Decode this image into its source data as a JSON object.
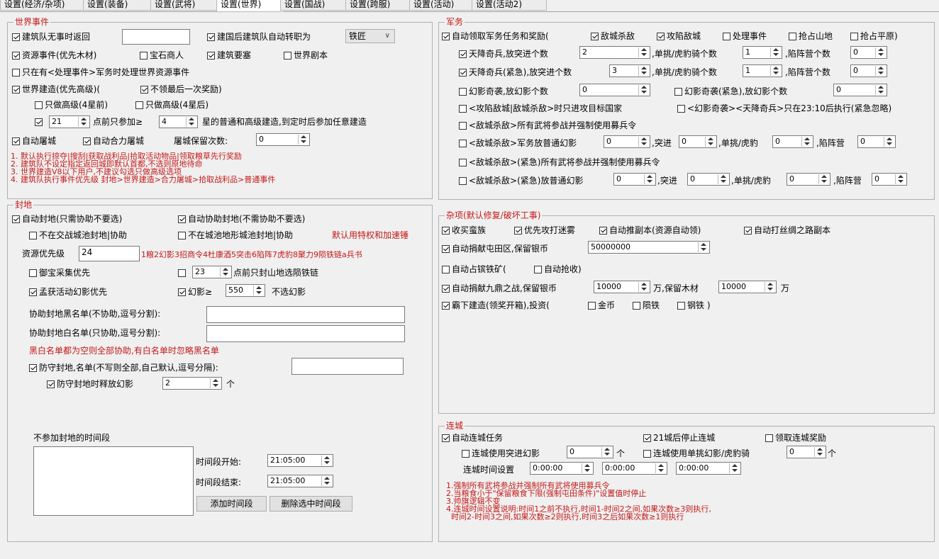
{
  "tabs": [
    {
      "label": "设置(经济/杂项)"
    },
    {
      "label": "设置(装备)"
    },
    {
      "label": "设置(武将)"
    },
    {
      "label": "设置(世界)"
    },
    {
      "label": "设置(国战)"
    },
    {
      "label": "设置(跨服)"
    },
    {
      "label": "设置(活动)"
    },
    {
      "label": "设置(活动2)"
    }
  ],
  "world": {
    "legend": "世界事件",
    "idle_return": "建筑队无事时返回",
    "idle_return_value": "",
    "auto_convert": "建国后建筑队自动转职为",
    "convert_option": "铁匠",
    "resource_event": "资源事件(优先木材)",
    "treasure_merchant": "宝石商人",
    "build_fortress": "建筑要塞",
    "world_script": "世界剧本",
    "only_handle": "只在有<处理事件>军务时处理世界资源事件",
    "world_build": "世界建造(优先高级)(",
    "no_last_reward": "不领最后一次奖励)",
    "high_before": "只做高级(4星前)",
    "high_after": "只做高级(4星后)",
    "stars_value": "21",
    "before_join": "点前只参加≥",
    "star_value": "4",
    "star_text": "星的普通和高级建造,到定时后参加任意建造",
    "auto_slay": "自动屠城",
    "auto_cooperate": "自动合力屠城",
    "slay_keep": "屠城保留次数:",
    "slay_keep_value": "0",
    "notes": [
      "1. 默认执行掠夺|搜刮|获取战利品|拾取活动物品|领取粮草先行奖励",
      "2. 建筑队不设定指定返回城即默认首都,不选则原地待命",
      "3. 世界建造V8以下用户,不建议勾选只做高级选项",
      "4. 建筑队执行事件优先级 封地>世界建造>合力屠城>拾取战利品>普通事件"
    ]
  },
  "fief": {
    "legend": "封地",
    "auto_fief": "自动封地(只需协助不要选)",
    "auto_assist": "自动协助封地(不需协助不要选)",
    "not_battle": "不在交战城池封地|协助",
    "not_terrain": "不在城池地形城池封地|协助",
    "default_use": "默认用特权和加速锤",
    "res_priority": "资源优先级",
    "res_priority_value": "24",
    "res_hint": "1粮2幻影3招商令4杜康酒5突击6陷阵7虎豹8聚力9陨铁链a兵书",
    "treasure_first": "御宝采集优先",
    "hour_value": "23",
    "before_mountain": "点前只封山地选陨铁链",
    "mengzhuo": "孟获活动幻影优先",
    "phantom": "幻影≥",
    "phantom_value": "550",
    "no_phantom": "不选幻影",
    "blacklist": "协助封地黑名单(不协助,逗号分割):",
    "blacklist_value": "",
    "whitelist": "协助封地白名单(只协助,逗号分割):",
    "whitelist_value": "",
    "bw_hint": "黑白名单都为空则全部协助,有白名单时忽略黑名单",
    "defend": "防守封地,名单(不写则全部,自己默认,逗号分隔):",
    "defend_value": "",
    "defend_release": "防守封地时释放幻影",
    "defend_release_value": "2",
    "unit_ge": "个",
    "no_join_period": "不参加封地的时间段",
    "start_label": "时间段开始:",
    "start_value": "21:05:00",
    "end_label": "时间段结束:",
    "end_value": "21:05:00",
    "add_btn": "添加时间段",
    "del_btn": "删除选中时间段"
  },
  "military": {
    "legend": "军务",
    "auto_claim": "自动领取军务任务和奖励(",
    "kill_enemy": "敌城杀敌",
    "attack_city": "攻陷敌城",
    "handle_event": "处理事件",
    "grab_mountain": "抢占山地",
    "grab_plain": "抢占平原)",
    "tj1": "天降奇兵,放突进个数",
    "tj1_v1": "2",
    "single": ",单挑/虎豹骑个数",
    "tj1_v2": "1",
    "trap": ",陷阵营个数",
    "tj1_v3": "0",
    "tj2": "天降奇兵(紧急),放突进个数",
    "tj2_v1": "3",
    "tj2_v2": "1",
    "tj2_v3": "0",
    "hy1": "幻影奇袭,放幻影个数",
    "hy1_v": "0",
    "hy2": "幻影奇袭(紧急),放幻影个数",
    "hy2_v": "0",
    "target_country": "<攻陷敌城|敌城杀敌>时只进攻目标国家",
    "after_2310": "<幻影奇袭><天降奇兵>只在23:10后执行(紧急忽略)",
    "force_recruit": "<敌城杀敌>所有武将参战并强制使用募兵令",
    "normal_phantom": "<敌城杀敌>军务放普通幻影",
    "np_v1": "0",
    "charge": ",突进",
    "np_v2": "0",
    "single2": ",单挑/虎豹",
    "np_v3": "0",
    "trap2": ",陷阵营",
    "np_v4": "0",
    "urgent_force": "<敌城杀敌>(紧急)所有武将参战并强制使用募兵令",
    "urgent_phantom": "<敌城杀敌>(紧急)放普通幻影",
    "up_v1": "0",
    "up_v2": "0",
    "up_v3": "0",
    "up_v4": "0"
  },
  "misc": {
    "legend": "杂项(默认修复/破坏工事)",
    "buy_barb": "收买蛮族",
    "fog_first": "优先攻打迷雾",
    "auto_dungeon": "自动推副本(资源自动领)",
    "silk_road": "自动打丝绸之路副本",
    "donate_farm": "自动捐献屯田区,保留银币",
    "donate_farm_value": "50000000",
    "occupy_mine": "自动占镔铁矿(",
    "auto_grab": "自动抢收)",
    "donate_jiuding": "自动捐献九鼎之战,保留银币",
    "jd_silver": "10000",
    "wan_keep_wood": "万,保留木材",
    "jd_wood": "10000",
    "wan": "万",
    "bawang": "霸下建造(领奖开箱),投资(",
    "gold": "金币",
    "meteor": "陨铁",
    "steel": "钢铁 )"
  },
  "chain": {
    "legend": "连城",
    "auto_chain": "自动连城任务",
    "stop_21": "21城后停止连城",
    "claim_reward": "领取连城奖励",
    "use_charge": "连城使用突进幻影",
    "charge_value": "0",
    "ge": "个",
    "use_single": "连城使用单挑幻影/虎豹骑",
    "single_value": "0",
    "time_label": "连城时间设置",
    "t1": "0:00:00",
    "t2": "0:00:00",
    "t3": "0:00:00",
    "notes": [
      "1.强制所有武将参战并强制所有武将使用募兵令",
      "2.当粮食小于\"保留粮食下限(强制屯田条件)\"设置值时停止",
      "3.帅旗逻辑不变",
      "4.连城时间设置说明:时间1之前不执行,时间1-时间2之间,如果次数≥3则执行,",
      "  时间2-时间3之间,如果次数≥2则执行,时间3之后如果次数≥1则执行"
    ]
  }
}
